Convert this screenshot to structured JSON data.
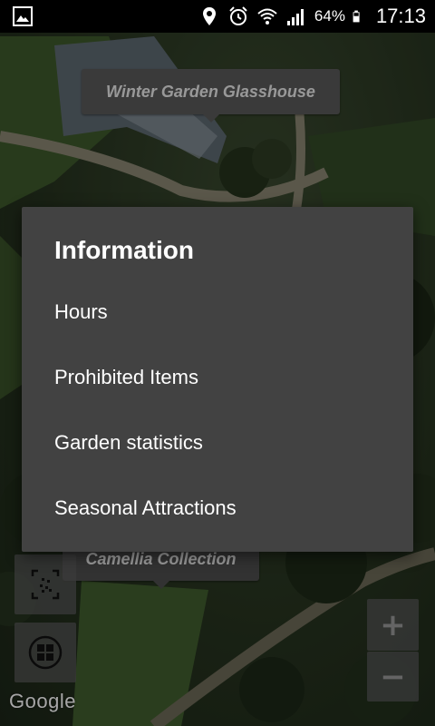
{
  "status_bar": {
    "battery_percent": "64%",
    "time": "17:13",
    "icons": [
      "gallery-icon",
      "location-icon",
      "alarm-icon",
      "wifi-icon",
      "signal-icon",
      "battery-icon"
    ]
  },
  "map": {
    "markers": [
      {
        "label": "Winter Garden Glasshouse"
      },
      {
        "label": "Camellia Collection"
      }
    ],
    "controls": {
      "zoom_in": "+",
      "zoom_out": "−",
      "scan_icon": "scan-icon",
      "layers_icon": "layers-icon"
    },
    "attribution": "Google"
  },
  "dialog": {
    "title": "Information",
    "items": [
      {
        "label": "Hours"
      },
      {
        "label": "Prohibited Items"
      },
      {
        "label": "Garden statistics"
      },
      {
        "label": "Seasonal Attractions"
      }
    ]
  },
  "colors": {
    "dialog_background": "#424242",
    "marker_background": "#595959",
    "status_bar": "#000000"
  }
}
